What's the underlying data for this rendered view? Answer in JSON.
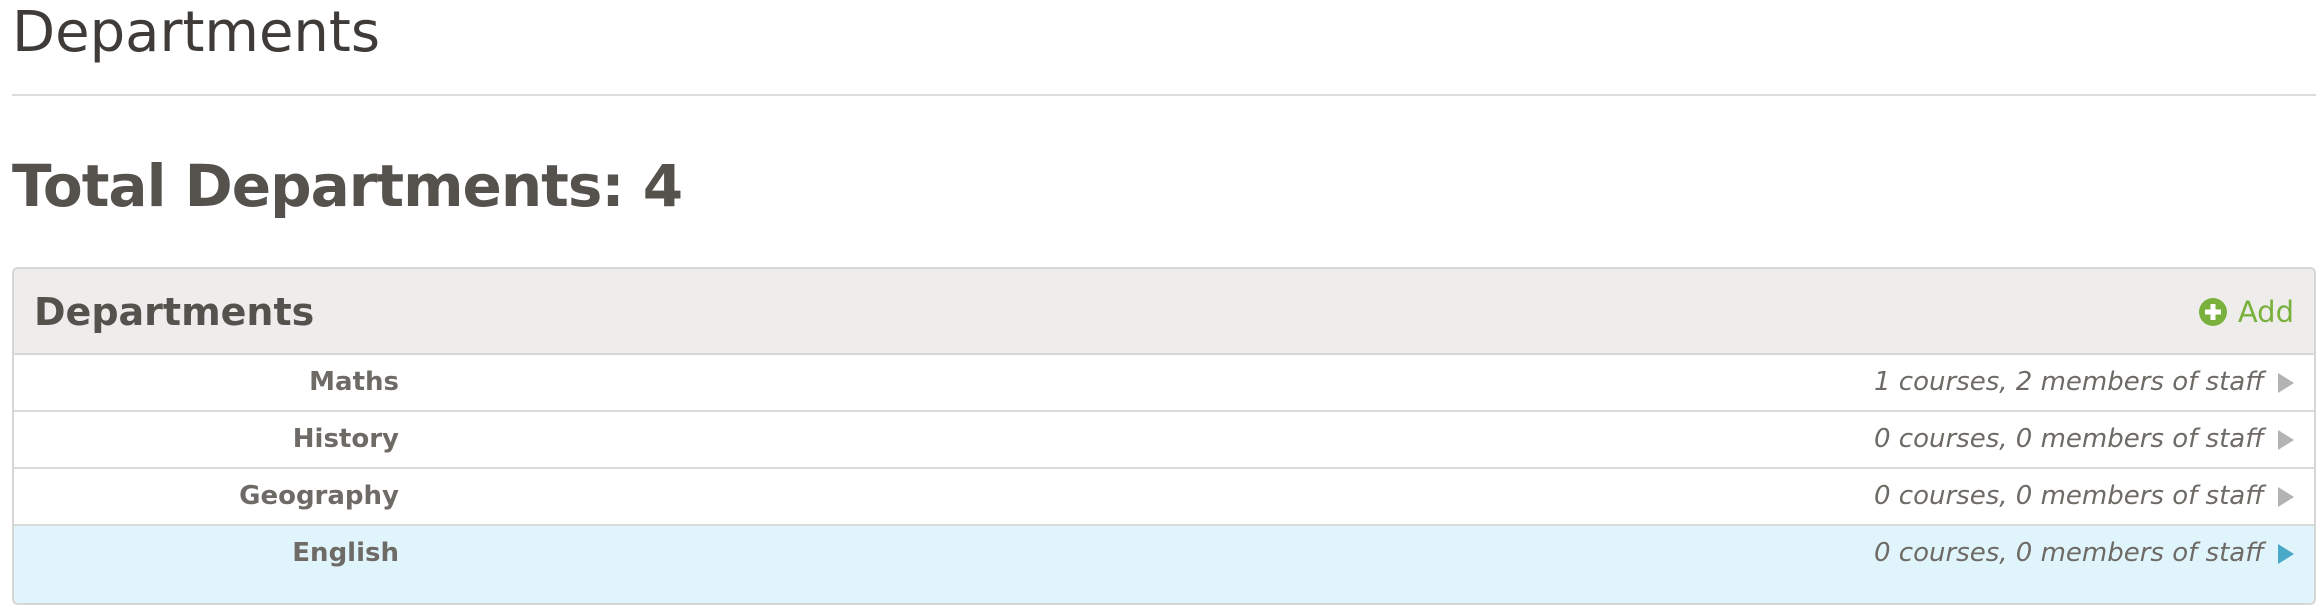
{
  "page": {
    "title": "Departments",
    "total_label": "Total Departments: 4"
  },
  "panel": {
    "title": "Departments",
    "add_label": "Add",
    "add_icon": "plus-circle-icon",
    "add_color": "#7ab03c"
  },
  "departments": [
    {
      "name": "Maths",
      "summary": "1 courses, 2 members of staff",
      "arrow_icon": "chevron-right-icon",
      "arrow_color": "#b3b3b3",
      "selected": false
    },
    {
      "name": "History",
      "summary": "0 courses, 0 members of staff",
      "arrow_icon": "chevron-right-icon",
      "arrow_color": "#b3b3b3",
      "selected": false
    },
    {
      "name": "Geography",
      "summary": "0 courses, 0 members of staff",
      "arrow_icon": "chevron-right-icon",
      "arrow_color": "#b3b3b3",
      "selected": false
    },
    {
      "name": "English",
      "summary": "0 courses, 0 members of staff",
      "arrow_icon": "chevron-right-icon",
      "arrow_color": "#4aa8c8",
      "selected": true
    }
  ],
  "colors": {
    "selected_row_bg": "#e0f5fb",
    "header_bg": "#eeedeb"
  }
}
